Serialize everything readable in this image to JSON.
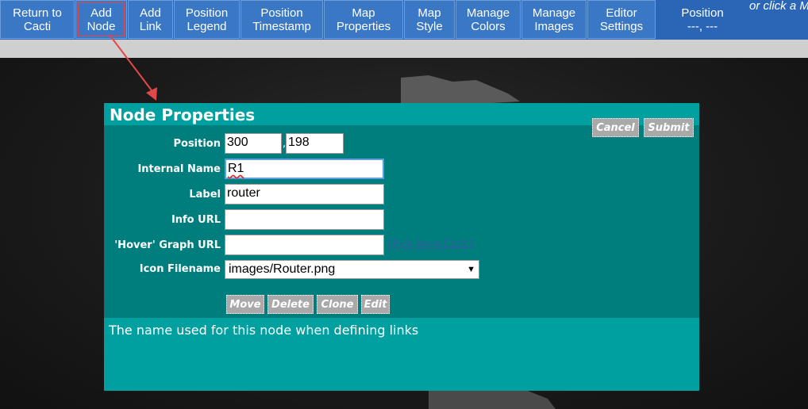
{
  "toolbar": {
    "buttons": [
      {
        "line1": "Return to",
        "line2": "Cacti"
      },
      {
        "line1": "Add",
        "line2": "Node"
      },
      {
        "line1": "Add",
        "line2": "Link"
      },
      {
        "line1": "Position",
        "line2": "Legend"
      },
      {
        "line1": "Position",
        "line2": "Timestamp"
      },
      {
        "line1": "Map",
        "line2": "Properties"
      },
      {
        "line1": "Map",
        "line2": "Style"
      },
      {
        "line1": "Manage",
        "line2": "Colors"
      },
      {
        "line1": "Manage",
        "line2": "Images"
      },
      {
        "line1": "Editor",
        "line2": "Settings"
      }
    ],
    "position": {
      "label": "Position",
      "value": "---, ---"
    },
    "hint": "or click a M"
  },
  "dialog": {
    "title": "Node Properties",
    "cancel_label": "Cancel",
    "submit_label": "Submit",
    "position_label": "Position",
    "position_x": "300",
    "position_y": "198",
    "internal_name_label": "Internal Name",
    "internal_name_value": "R1",
    "label_label": "Label",
    "label_value": "router",
    "info_url_label": "Info URL",
    "info_url_value": "",
    "hover_graph_label": "'Hover' Graph URL",
    "hover_graph_value": "",
    "pick_link": "[Pick from Cacti]",
    "icon_label": "Icon Filename",
    "icon_value": "images/Router.png",
    "actions": {
      "move": "Move",
      "delete": "Delete",
      "clone": "Clone",
      "edit": "Edit"
    },
    "help_text": "The name used for this node when defining links"
  },
  "colors": {
    "toolbar": "#2b66b6",
    "dialog_bg": "#007e7e",
    "dialog_header": "#00a0a0",
    "annotation_arrow": "#e14848"
  }
}
